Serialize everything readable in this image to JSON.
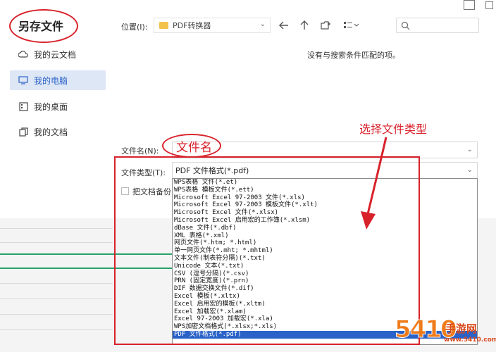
{
  "dialog": {
    "title": "另存文件",
    "max_glyph": "□"
  },
  "sidebar": {
    "items": [
      {
        "label": "我的云文档",
        "icon": "cloud-icon",
        "active": false
      },
      {
        "label": "我的电脑",
        "icon": "monitor-icon",
        "active": true
      },
      {
        "label": "我的桌面",
        "icon": "desktop-icon",
        "active": false
      },
      {
        "label": "我的文档",
        "icon": "documents-icon",
        "active": false
      }
    ]
  },
  "location": {
    "label": "位置(I):",
    "value": "PDF转换器"
  },
  "main": {
    "empty_message": "没有与搜索条件匹配的项。"
  },
  "filename": {
    "label": "文件名(N):",
    "value": ""
  },
  "filetype": {
    "label": "文件类型(T):",
    "value": "PDF 文件格式(*.pdf)",
    "options": [
      "WPS表格 文件(*.et)",
      "WPS表格 模板文件(*.ett)",
      "Microsoft Excel 97-2003 文件(*.xls)",
      "Microsoft Excel 97-2003 模板文件(*.xlt)",
      "Microsoft Excel 文件(*.xlsx)",
      "Microsoft Excel 启用宏的工作簿(*.xlsm)",
      "dBase 文件(*.dbf)",
      "XML 表格(*.xml)",
      "网页文件(*.htm; *.html)",
      "单一网页文件(*.mht; *.mhtml)",
      "文本文件(制表符分隔)(*.txt)",
      "Unicode 文本(*.txt)",
      "CSV (逗号分隔)(*.csv)",
      "PRN (固定宽度)(*.prn)",
      "DIF 数据交换文件(*.dif)",
      "Excel 模板(*.xltx)",
      "Excel 启用宏的模板(*.xltm)",
      "Excel 加载宏(*.xlam)",
      "Excel 97-2003 加载宏(*.xla)",
      "WPS加密文档格式(*.xlsx;*.xls)",
      "PDF 文件格式(*.pdf)"
    ],
    "selected_index": 20
  },
  "backup": {
    "label": "把文档备份"
  },
  "annotations": {
    "filename_note": "文件名",
    "filetype_note": "选择文件类型",
    "color": "#d8222b"
  },
  "watermark": {
    "number": "5410",
    "name": "手游网",
    "url": "www.5410.com"
  },
  "colors": {
    "accent": "#2b62c7",
    "sidebar_active_bg": "#dde7f6",
    "folder": "#f2c24b"
  }
}
